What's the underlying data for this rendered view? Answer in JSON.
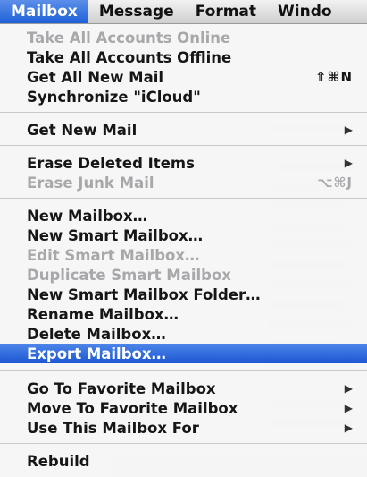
{
  "menubar": {
    "items": [
      "Mailbox",
      "Message",
      "Format",
      "Windo"
    ]
  },
  "menu": {
    "items": {
      "take_all_online": "Take All Accounts Online",
      "take_all_offline": "Take All Accounts Offline",
      "get_all_new_mail": "Get All New Mail",
      "get_all_new_mail_shortcut": "⇧⌘N",
      "synchronize": "Synchronize \"iCloud\"",
      "get_new_mail": "Get New Mail",
      "erase_deleted": "Erase Deleted Items",
      "erase_junk": "Erase Junk Mail",
      "erase_junk_shortcut": "⌥⌘J",
      "new_mailbox": "New Mailbox…",
      "new_smart_mailbox": "New Smart Mailbox…",
      "edit_smart_mailbox": "Edit Smart Mailbox…",
      "duplicate_smart_mailbox": "Duplicate Smart Mailbox",
      "new_smart_mailbox_folder": "New Smart Mailbox Folder…",
      "rename_mailbox": "Rename Mailbox…",
      "delete_mailbox": "Delete Mailbox…",
      "export_mailbox": "Export Mailbox…",
      "go_to_favorite": "Go To Favorite Mailbox",
      "move_to_favorite": "Move To Favorite Mailbox",
      "use_this_mailbox_for": "Use This Mailbox For",
      "rebuild": "Rebuild"
    },
    "submenu_glyph": "▶"
  },
  "colors": {
    "highlight": "#1c56d3",
    "disabled_text": "#a8a8ab"
  }
}
